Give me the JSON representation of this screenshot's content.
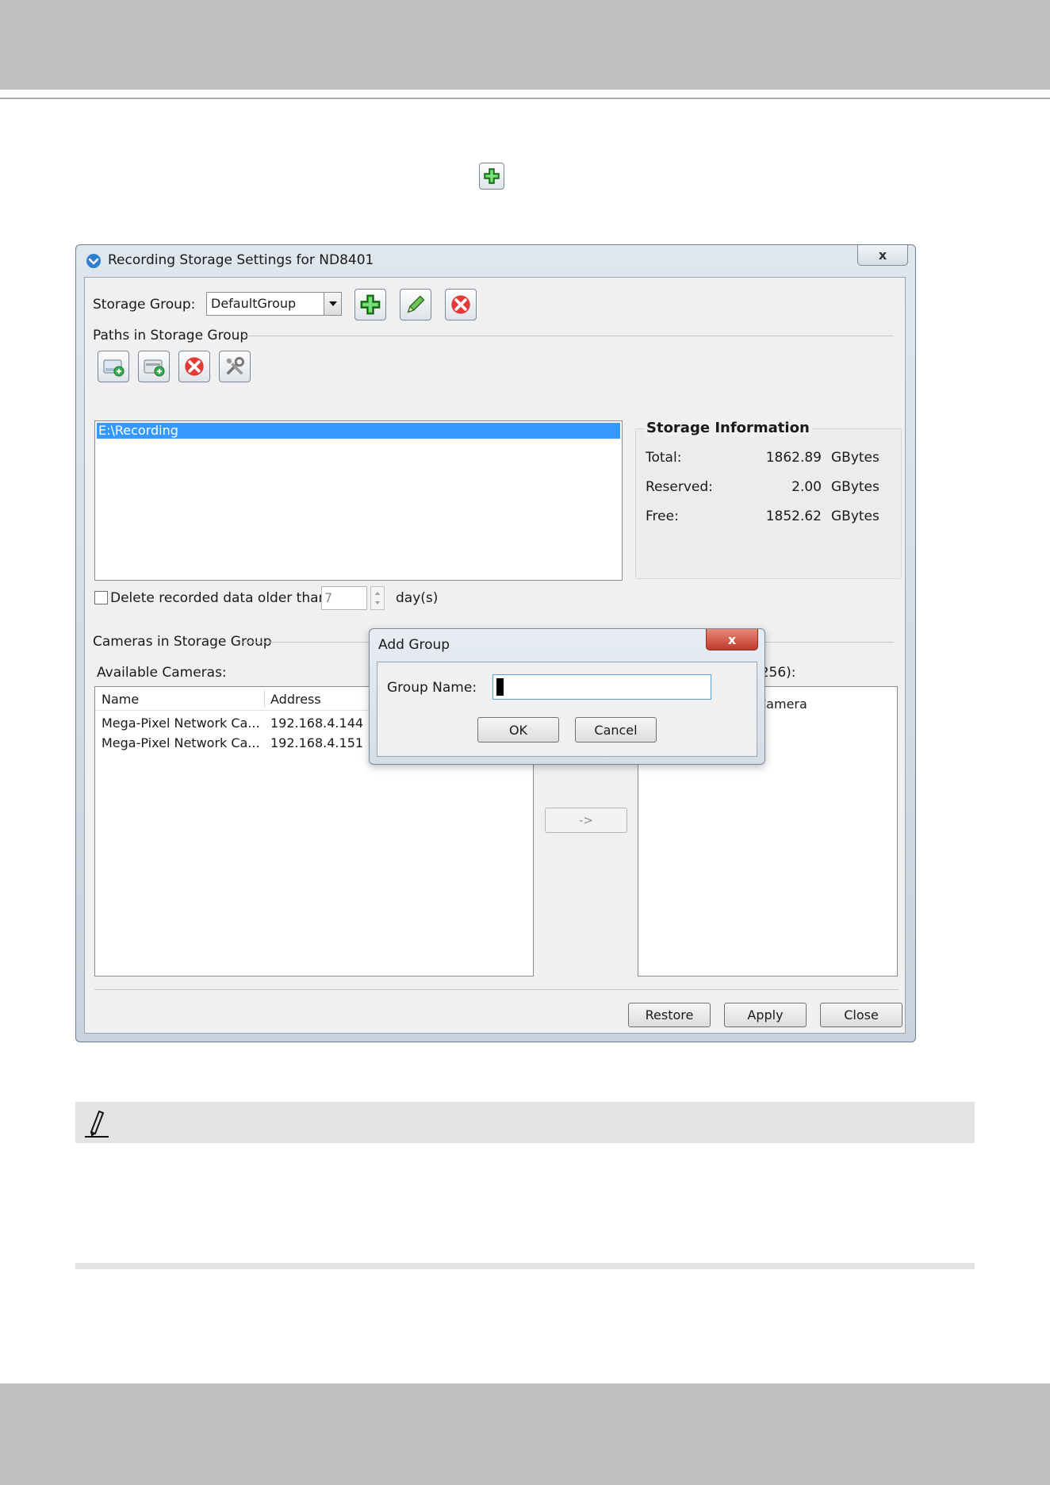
{
  "window": {
    "title": "Recording Storage Settings for ND8401",
    "close_glyph": "x"
  },
  "storage_group": {
    "label": "Storage Group:",
    "selected": "DefaultGroup"
  },
  "paths": {
    "section_label": "Paths in Storage Group",
    "items": [
      "E:\\Recording"
    ]
  },
  "storage_info": {
    "title": "Storage Information",
    "rows": [
      {
        "label": "Total:",
        "value": "1862.89",
        "unit": "GBytes"
      },
      {
        "label": "Reserved:",
        "value": "2.00",
        "unit": "GBytes"
      },
      {
        "label": "Free:",
        "value": "1852.62",
        "unit": "GBytes"
      }
    ]
  },
  "retention": {
    "label": "Delete recorded data older than",
    "days_value": "7",
    "unit": "day(s)"
  },
  "cameras": {
    "section_label": "Cameras in Storage Group",
    "available_label": "Available Cameras:",
    "assigned_label_fragment": "/256):",
    "columns": [
      "Name",
      "Address"
    ],
    "rows": [
      {
        "name": "Mega-Pixel Network Ca...",
        "address": "192.168.4.144"
      },
      {
        "name": "Mega-Pixel Network Ca...",
        "address": "192.168.4.151"
      }
    ],
    "move_button": "->",
    "assigned_items": [
      "Camera"
    ]
  },
  "buttons": {
    "restore": "Restore",
    "apply": "Apply",
    "close": "Close"
  },
  "add_group_dialog": {
    "title": "Add Group",
    "close_glyph": "x",
    "name_label": "Group Name:",
    "name_value": "",
    "ok": "OK",
    "cancel": "Cancel"
  },
  "icons": {
    "add": "plus-icon",
    "edit": "pencil-icon",
    "delete": "red-x-icon",
    "add_path": "add-folder-icon",
    "add_path_network": "add-network-folder-icon",
    "tools": "tools-icon",
    "note": "note-pencil-icon"
  },
  "colors": {
    "selection": "#3399ff",
    "page_band": "#bfbfbf",
    "note_bar": "#e3e3e3"
  }
}
